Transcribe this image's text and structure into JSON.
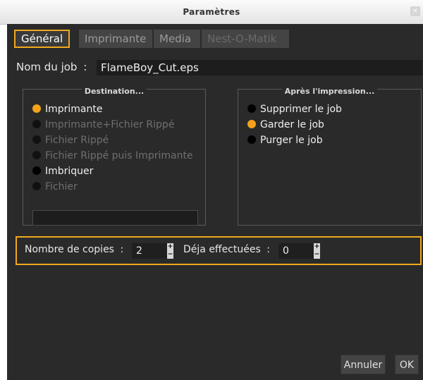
{
  "window": {
    "title": "Paramètres",
    "close_glyph": "×"
  },
  "tabs": [
    {
      "label": "Général",
      "state": "active"
    },
    {
      "label": "Imprimante",
      "state": "normal"
    },
    {
      "label": "Media",
      "state": "normal"
    },
    {
      "label": "Nest-O-Matik",
      "state": "disabled"
    }
  ],
  "job": {
    "label": "Nom du job",
    "separator": ":",
    "value": "FlameBoy_Cut.eps"
  },
  "destination": {
    "title": "Destination...",
    "options": [
      {
        "label": "Imprimante",
        "selected": true,
        "enabled": true
      },
      {
        "label": "Imprimante+Fichier Rippé",
        "selected": false,
        "enabled": false
      },
      {
        "label": "Fichier Rippé",
        "selected": false,
        "enabled": false
      },
      {
        "label": "Fichier Rippé puis Imprimante",
        "selected": false,
        "enabled": false
      },
      {
        "label": "Imbriquer",
        "selected": false,
        "enabled": true
      },
      {
        "label": "Fichier",
        "selected": false,
        "enabled": false
      }
    ],
    "file_value": ""
  },
  "after_print": {
    "title": "Après l'impression...",
    "options": [
      {
        "label": "Supprimer le job",
        "selected": false,
        "enabled": true
      },
      {
        "label": "Garder le job",
        "selected": true,
        "enabled": true
      },
      {
        "label": "Purger le job",
        "selected": false,
        "enabled": true
      }
    ]
  },
  "copies": {
    "label": "Nombre de copies",
    "separator": ":",
    "value": "2",
    "done_label": "Déja effectuées",
    "done_separator": ":",
    "done_value": "0",
    "up_glyph": "+",
    "down_glyph": "−"
  },
  "buttons": {
    "cancel": "Annuler",
    "ok": "OK"
  },
  "colors": {
    "accent": "#f0a81e",
    "background": "#2a2a2a",
    "titlebar": "#eeeeee"
  }
}
